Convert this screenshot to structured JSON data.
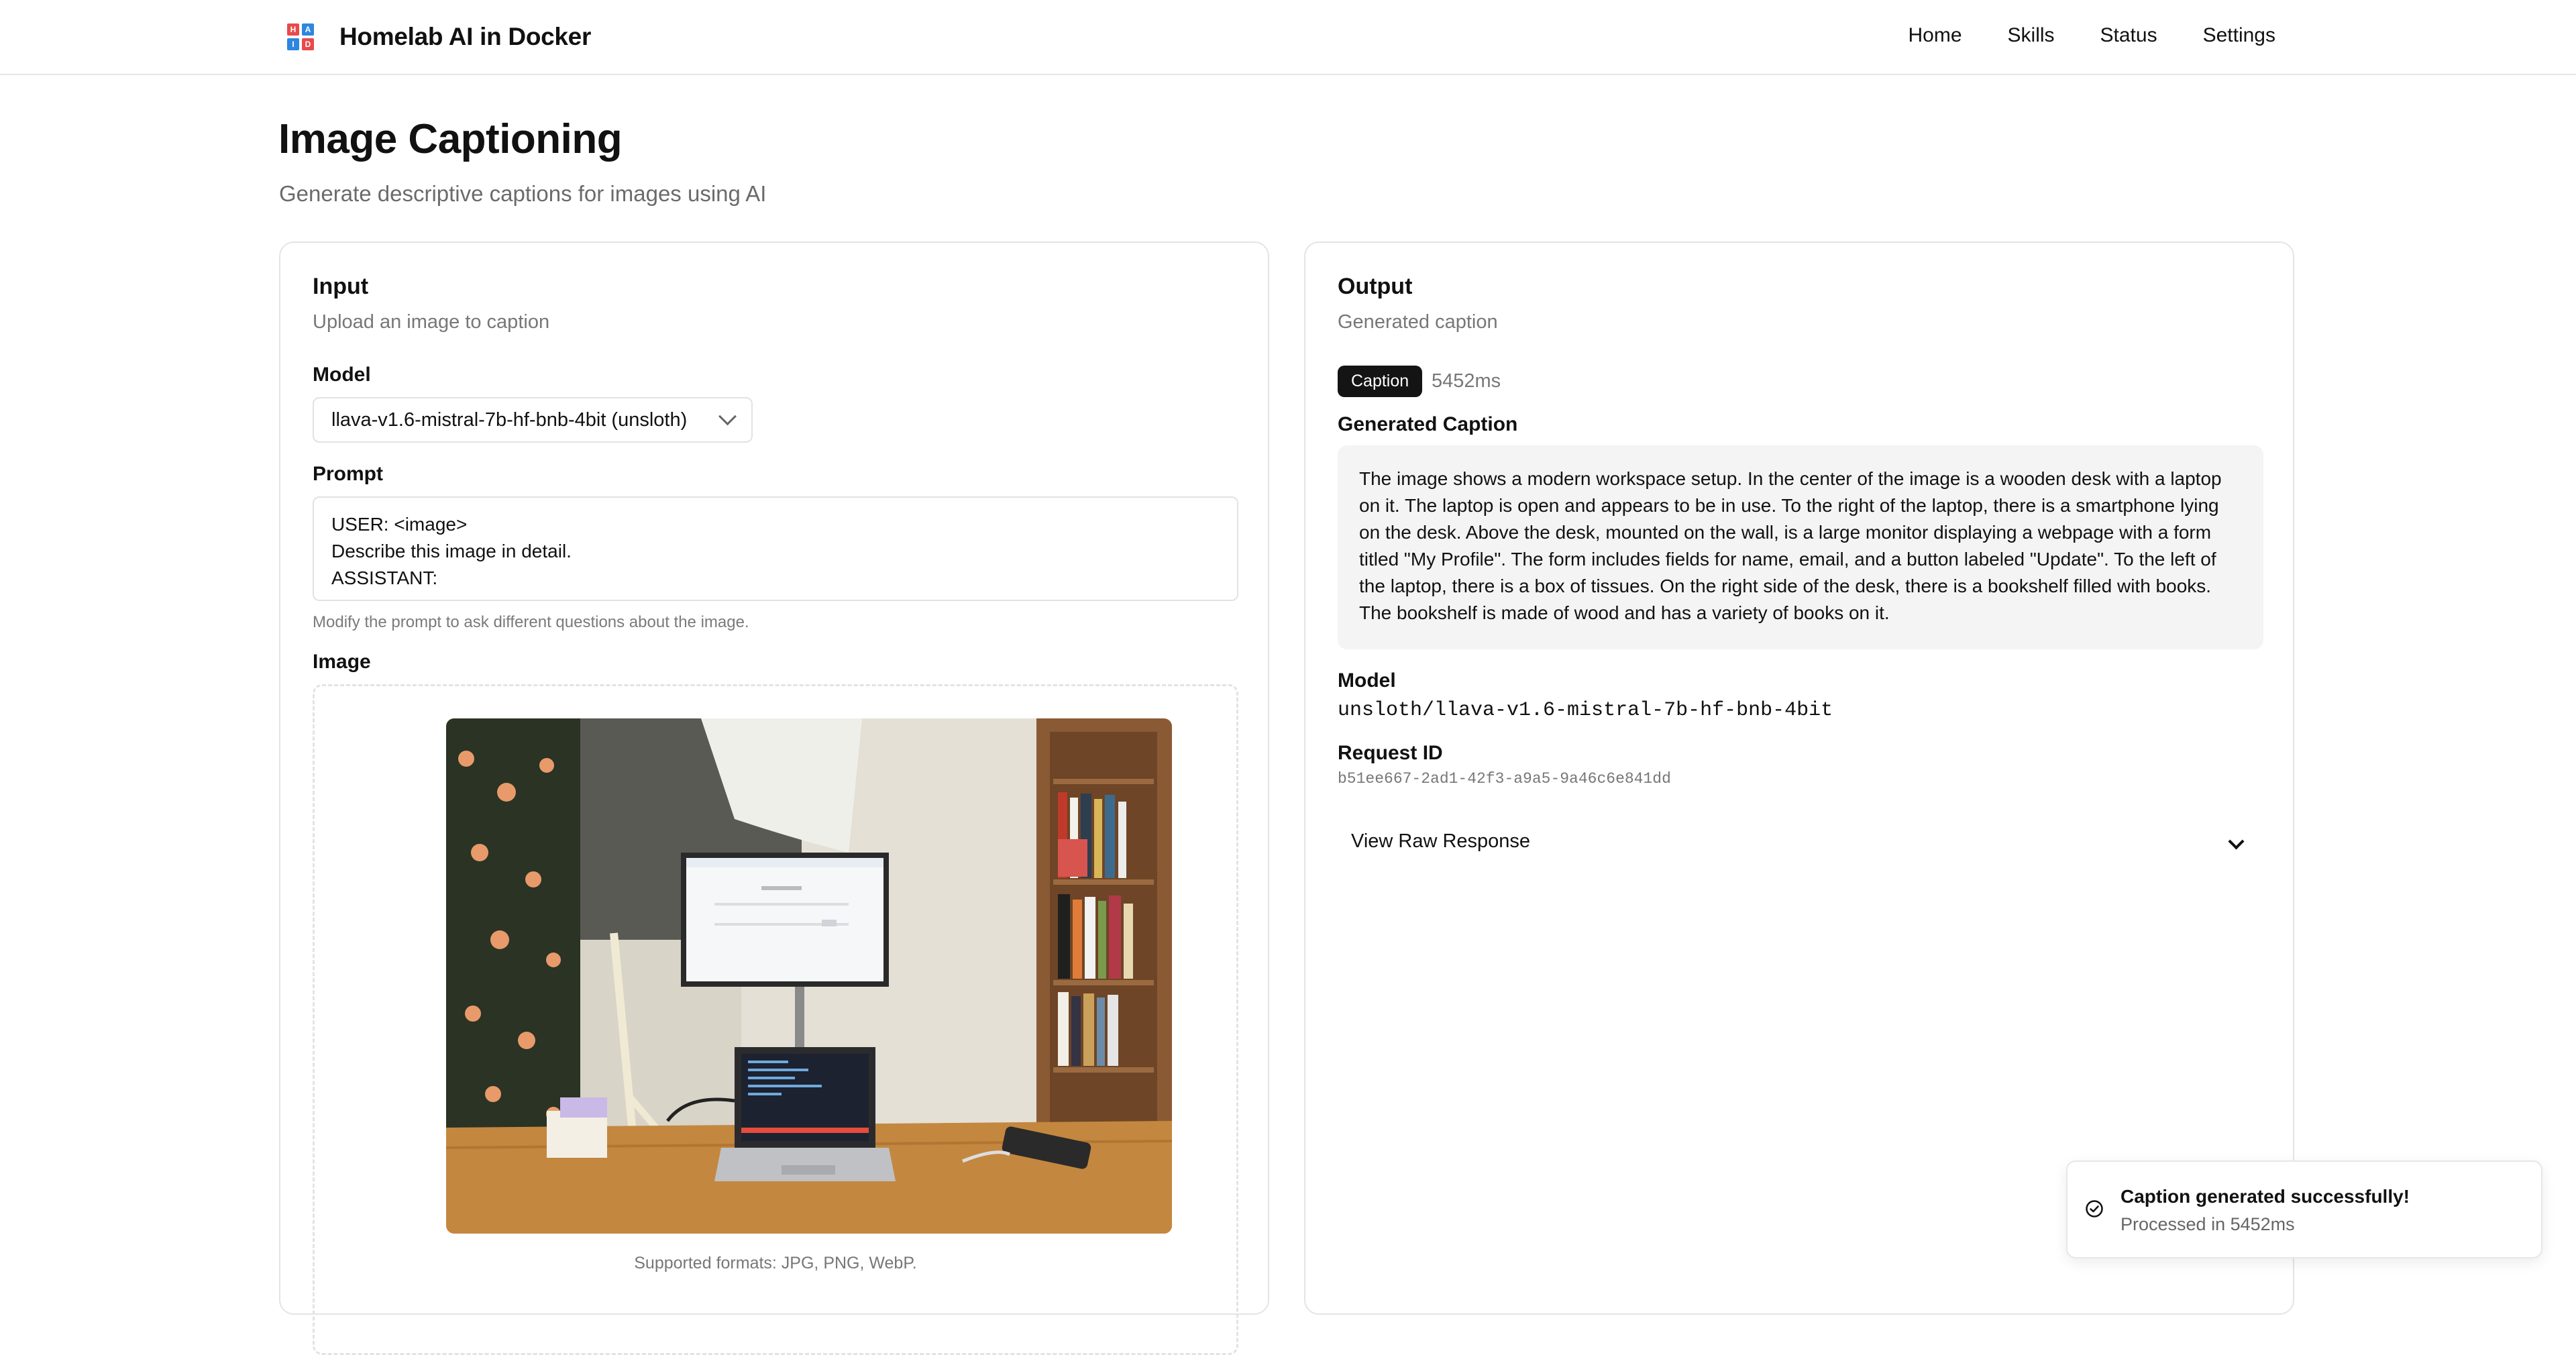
{
  "header": {
    "app_title": "Homelab AI in Docker",
    "logo_letters": [
      "H",
      "A",
      "I",
      "D"
    ],
    "nav": [
      "Home",
      "Skills",
      "Status",
      "Settings"
    ]
  },
  "page": {
    "title": "Image Captioning",
    "subtitle": "Generate descriptive captions for images using AI"
  },
  "input": {
    "title": "Input",
    "subtitle": "Upload an image to caption",
    "model_label": "Model",
    "model_value": "llava-v1.6-mistral-7b-hf-bnb-4bit (unsloth)",
    "prompt_label": "Prompt",
    "prompt_value": "USER: <image>\nDescribe this image in detail.\nASSISTANT:",
    "prompt_hint": "Modify the prompt to ask different questions about the image.",
    "image_label": "Image",
    "formats": "Supported formats: JPG, PNG, WebP."
  },
  "output": {
    "title": "Output",
    "subtitle": "Generated caption",
    "badge": "Caption",
    "timing": "5452ms",
    "caption_label": "Generated Caption",
    "caption": "The image shows a modern workspace setup. In the center of the image is a wooden desk with a laptop on it. The laptop is open and appears to be in use. To the right of the laptop, there is a smartphone lying on the desk. Above the desk, mounted on the wall, is a large monitor displaying a webpage with a form titled \"My Profile\". The form includes fields for name, email, and a button labeled \"Update\". To the left of the laptop, there is a box of tissues. On the right side of the desk, there is a bookshelf filled with books. The bookshelf is made of wood and has a variety of books on it.",
    "model_label": "Model",
    "model_value": "unsloth/llava-v1.6-mistral-7b-hf-bnb-4bit",
    "request_label": "Request ID",
    "request_id": "b51ee667-2ad1-42f3-a9a5-9a46c6e841dd",
    "raw_toggle": "View Raw Response"
  },
  "toast": {
    "title": "Caption generated successfully!",
    "detail": "Processed in 5452ms"
  },
  "colors": {
    "logo": [
      "#e84a4a",
      "#2e86de",
      "#2e86de",
      "#e84a4a"
    ],
    "badge_bg": "#141414",
    "caption_bg": "#f4f4f4"
  }
}
